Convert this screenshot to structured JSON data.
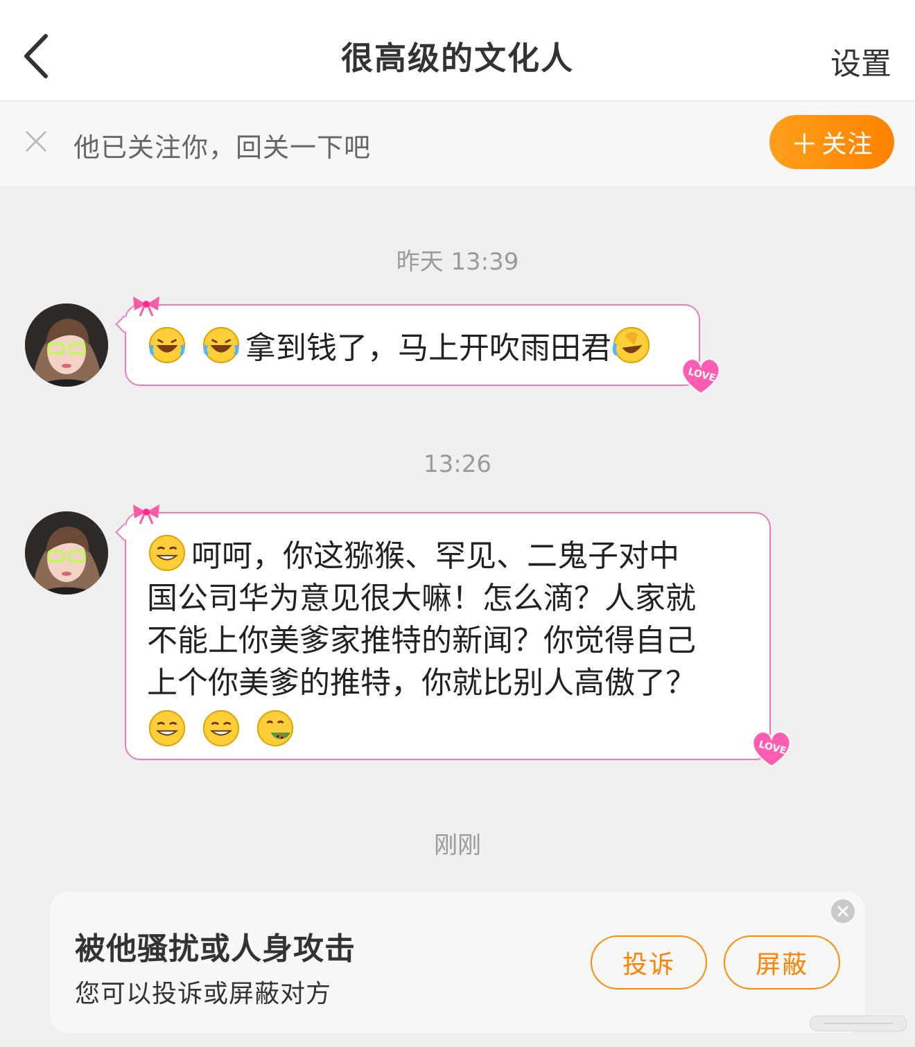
{
  "header": {
    "title": "很高级的文化人",
    "settings_label": "设置"
  },
  "follow_bar": {
    "text": "他已关注你，回关一下吧",
    "button_plus": "＋",
    "button_label": "关注"
  },
  "messages": [
    {
      "timestamp": "昨天 13:39",
      "lines": [
        "拿到钱了，马上开吹雨田君"
      ],
      "emojis_before": [
        "laughing-tears-emoji",
        "laughing-tears-emoji"
      ],
      "emojis_after": [
        "rolling-laughing-emoji"
      ]
    },
    {
      "timestamp": "13:26",
      "lines": [
        "呵呵，你这猕猴、罕见、二鬼子对中",
        "国公司华为意见很大嘛！怎么滴？人家就",
        "不能上你美爹家推特的新闻？你觉得自己",
        "上个你美爹的推特，你就比别人高傲了？"
      ],
      "emojis_before": [
        "smirk-emoji"
      ],
      "emojis_after": [
        "smirk-emoji",
        "smirk-emoji",
        "eating-watermelon-emoji"
      ]
    }
  ],
  "last_timestamp": "刚刚",
  "alert": {
    "title": "被他骚扰或人身攻击",
    "subtitle": "您可以投诉或屏蔽对方",
    "report_label": "投诉",
    "block_label": "屏蔽"
  },
  "colors": {
    "accent": "#ff8200",
    "bubble_border": "#f07ab8",
    "background": "#efefef"
  }
}
